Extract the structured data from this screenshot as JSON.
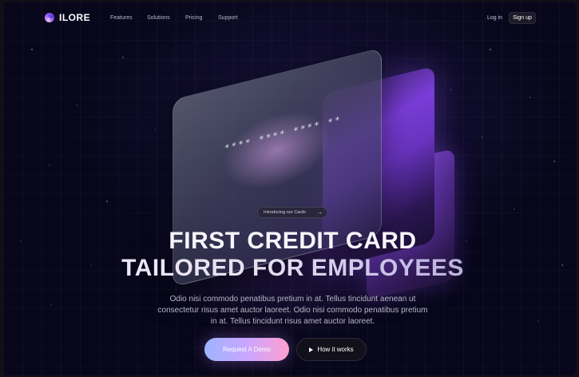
{
  "header": {
    "logo": "ILORE",
    "nav": [
      "Features",
      "Solutions",
      "Pricing",
      "Support"
    ],
    "login": "Log in",
    "signup": "Sign up"
  },
  "cards": {
    "front_number": "**** **** **** **"
  },
  "hero": {
    "badge": "Introducing our Cards",
    "headline_line1": "FIRST CREDIT CARD",
    "headline_line2": "TAILORED FOR EMPLOYEES",
    "description_lines": [
      "Odio nisi commodo penatibus pretium in at. Tellus tincidunt aenean ut",
      "consectetur risus amet auctor laoreet. Odio nisi commodo penatibus pretium",
      "in at. Tellus tincidunt risus amet auctor laoreet."
    ],
    "primary_button": "Request A Demo",
    "secondary_button": "How it works"
  },
  "colors": {
    "background": "#07061a",
    "accent_purple": "#7a3dd8",
    "button_gradient": [
      "#9db4ff",
      "#c9a6ff",
      "#ff9fd0"
    ]
  },
  "icons": {
    "logo": "logo-swirl-icon",
    "badge_arrow": "arrow-right-icon",
    "play": "play-icon"
  }
}
